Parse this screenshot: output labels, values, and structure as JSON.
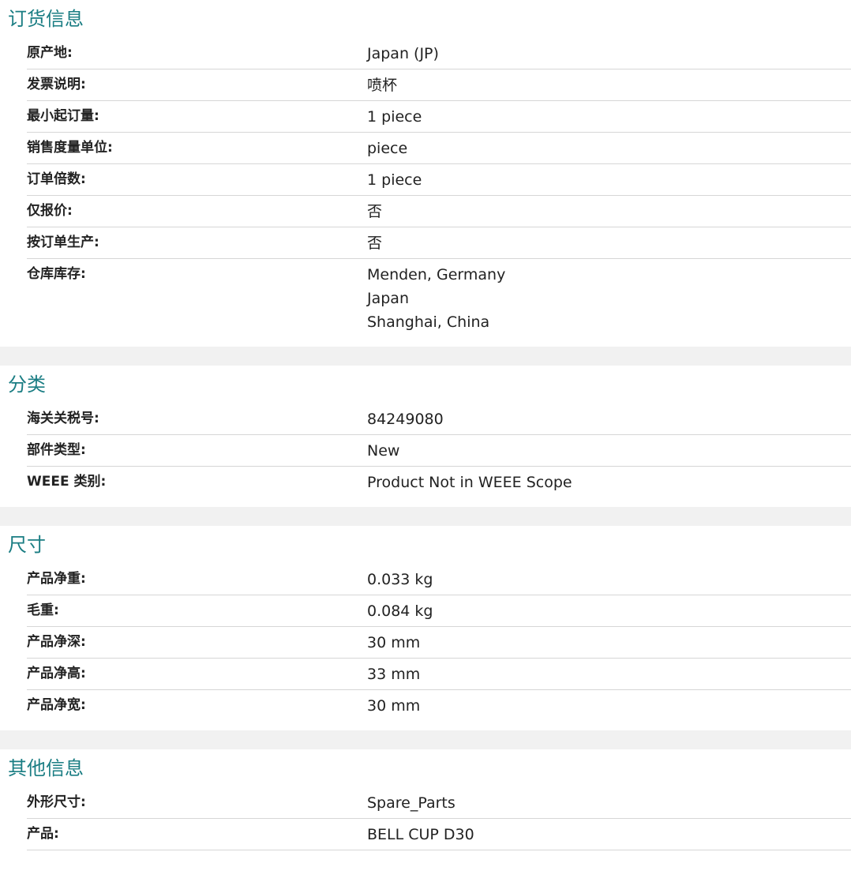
{
  "sections": [
    {
      "title": "订货信息",
      "rows": [
        {
          "label": "原产地:",
          "value": "Japan (JP)"
        },
        {
          "label": "发票说明:",
          "value": "喷杯"
        },
        {
          "label": "最小起订量:",
          "value": "1 piece"
        },
        {
          "label": "销售度量单位:",
          "value": "piece"
        },
        {
          "label": "订单倍数:",
          "value": "1 piece"
        },
        {
          "label": "仅报价:",
          "value": "否"
        },
        {
          "label": "按订单生产:",
          "value": "否"
        },
        {
          "label": "仓库库存:",
          "lines": [
            "Menden, Germany",
            "Japan",
            "Shanghai, China"
          ]
        }
      ]
    },
    {
      "title": "分类",
      "rows": [
        {
          "label": "海关关税号:",
          "value": "84249080"
        },
        {
          "label": "部件类型:",
          "value": "New"
        },
        {
          "label": "WEEE 类别:",
          "value": "Product Not in WEEE Scope"
        }
      ]
    },
    {
      "title": "尺寸",
      "rows": [
        {
          "label": "产品净重:",
          "value": "0.033 kg"
        },
        {
          "label": "毛重:",
          "value": "0.084 kg"
        },
        {
          "label": "产品净深:",
          "value": "30 mm"
        },
        {
          "label": "产品净高:",
          "value": "33 mm"
        },
        {
          "label": "产品净宽:",
          "value": "30 mm"
        }
      ]
    },
    {
      "title": "其他信息",
      "rows": [
        {
          "label": "外形尺寸:",
          "value": "Spare_Parts"
        },
        {
          "label": "产品:",
          "value": "BELL CUP D30"
        }
      ]
    }
  ]
}
